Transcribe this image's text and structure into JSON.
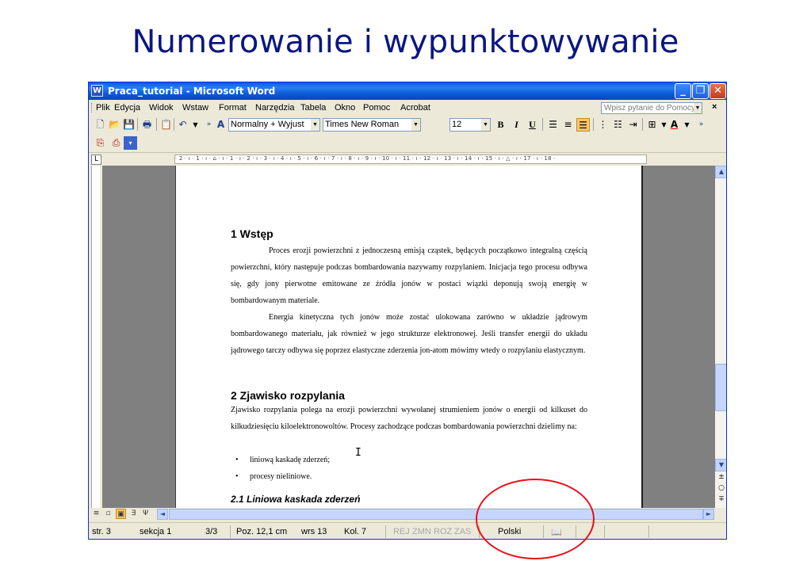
{
  "slide": {
    "title": "Numerowanie i wypunktowywanie"
  },
  "window": {
    "title": "Praca_tutorial - Microsoft Word",
    "min_glyph": "_",
    "max_glyph": "❐",
    "close_glyph": "✕"
  },
  "menu": {
    "items": [
      "Plik",
      "Edycja",
      "Widok",
      "Wstaw",
      "Format",
      "Narzędzia",
      "Tabela",
      "Okno",
      "Pomoc",
      "Acrobat"
    ],
    "help_placeholder": "Wpisz pytanie do Pomocy",
    "close_doc": "×"
  },
  "toolbar": {
    "style": "Normalny + Wyjust",
    "font": "Times New Roman",
    "size": "12",
    "bold": "B",
    "italic": "I",
    "underline": "U",
    "font_color": "A"
  },
  "ruler": {
    "text": "· 2 · ı · 1 · ı · ⌂ · ı · 1 · ı · 2 · ı · 3 · ı · 4 · ı · 5 · ı · 6 · ı · 7 · ı · 8 · ı · 9 · ı · 10 · ı · 11 · ı · 12 · ı · 13 · ı · 14 · ı · 15 · ı · △ · ı · 17 · ı · 18 ·",
    "tab_selector": "L"
  },
  "document": {
    "h1_1": "1   Wstęp",
    "para1a": "Proces erozji powierzchni z jednoczesną emisją cząstek, będących początkowo integralną częścią powierzchni, który następuje podczas bombardowania nazywamy rozpylaniem. Inicjacja tego procesu odbywa się, gdy jony pierwotne emitowane ze źródła jonów w postaci wiązki deponują swoją energię w bombardowanym materiale.",
    "para1b": "Energia kinetyczna tych jonów może zostać ulokowana zarówno w układzie jądrowym bombardowanego materiału, jak również w jego strukturze elektronowej. Jeśli transfer energii do układu jądrowego tarczy odbywa się poprzez elastyczne zderzenia jon-atom mówimy wtedy o rozpylaniu elastycznym.",
    "h1_2": "2   Zjawisko rozpylania",
    "para2": "Zjawisko rozpylania polega na erozji powierzchni wywołanej strumieniem jonów o energii od kilkuset do kilkudziesięciu kiloelektronowoltów. Procesy zachodzące podczas bombardowania powierzchni dzielimy na:",
    "bullets": [
      "liniową kaskadę zderzeń;",
      "procesy nieliniowe."
    ],
    "h2_1": "2.1  Liniowa kaskada zderzeń"
  },
  "statusbar": {
    "page": "str. 3",
    "section": "sekcja 1",
    "pages": "3/3",
    "pos": "Poz. 12,1 cm",
    "line": "wrs 13",
    "col": "Kol. 7",
    "rec": "REJ",
    "trk": "ZMN",
    "ext": "ROZ",
    "ovr": "ZAS",
    "lang": "Polski",
    "spell_icon": "book-check"
  },
  "annotation": {
    "color": "#e8111a"
  }
}
